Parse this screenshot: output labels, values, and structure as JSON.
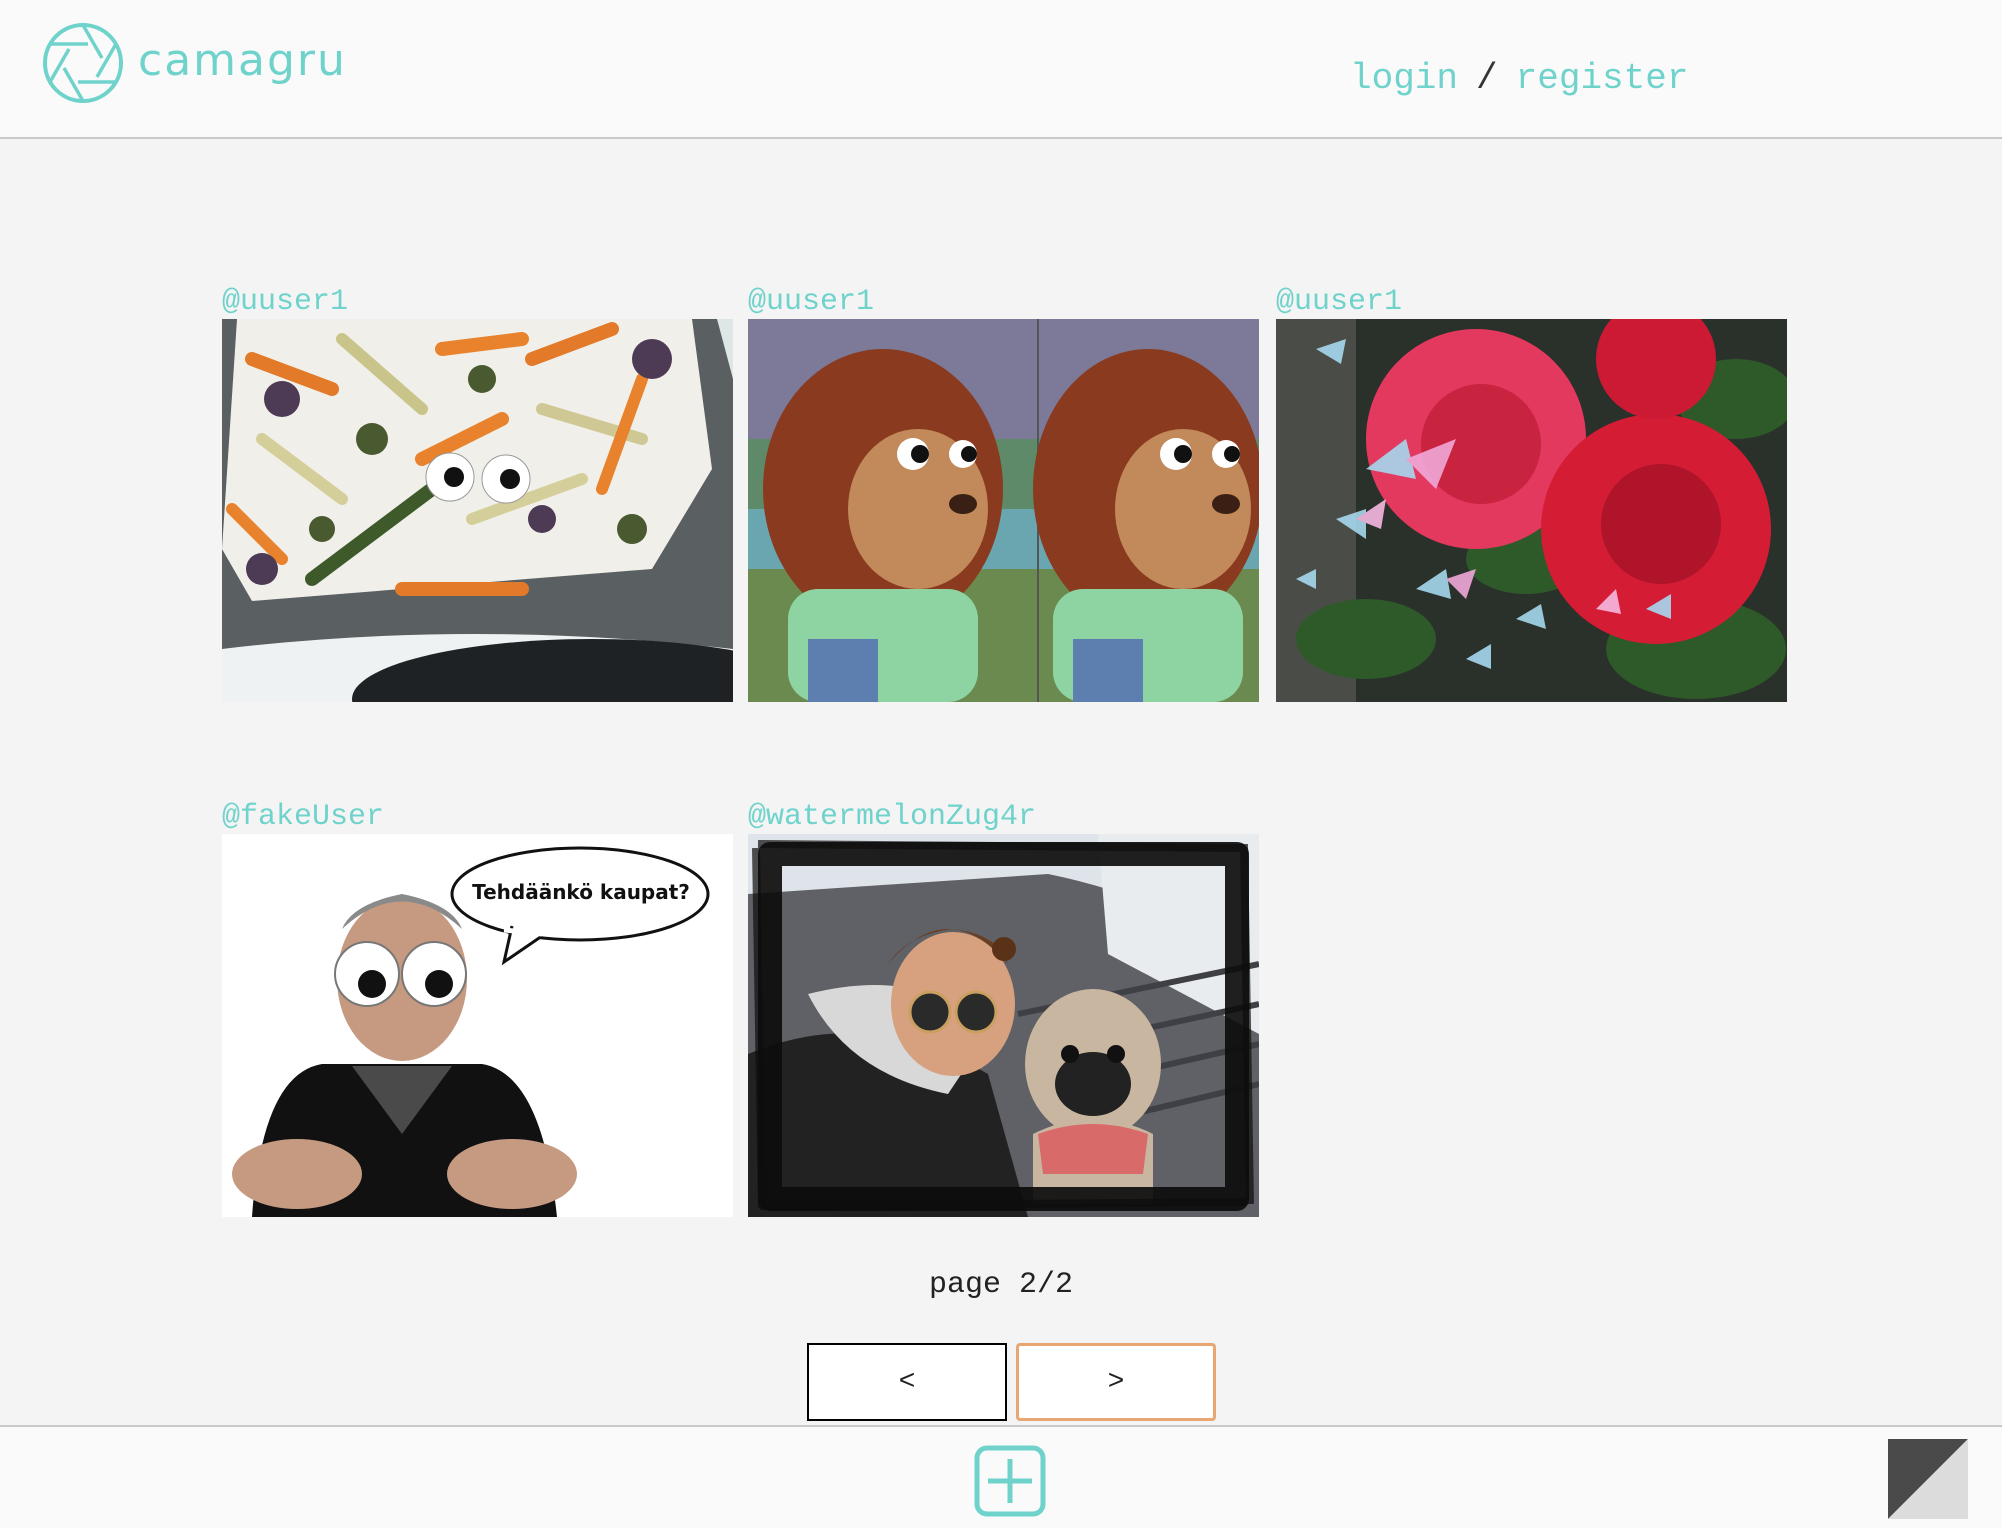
{
  "app": {
    "name": "camagru"
  },
  "header": {
    "login_label": "login",
    "separator": "/",
    "register_label": "register"
  },
  "gallery": {
    "posts": [
      {
        "user": "@uuser1",
        "image": "roasted vegetables on baking tray with googly eyes"
      },
      {
        "user": "@uuser1",
        "image": "side-eye puppet monkey meme"
      },
      {
        "user": "@uuser1",
        "image": "red roses with pastel butterflies"
      },
      {
        "user": "@fakeUser",
        "image": "man with googly eyes and speech bubble",
        "speech_bubble": "Tehdäänkö kaupat?"
      },
      {
        "user": "@watermelonZug4r",
        "image": "woman with sunglasses and pug in brush frame"
      }
    ]
  },
  "pagination": {
    "label": "page 2/2",
    "prev_label": "<",
    "next_label": ">"
  },
  "footer": {
    "add_icon": "plus-square-icon",
    "theme_icon": "theme-toggle-icon"
  },
  "colors": {
    "accent": "#6fd3cc",
    "next_border": "#e8a672",
    "background": "#f4f4f4"
  }
}
